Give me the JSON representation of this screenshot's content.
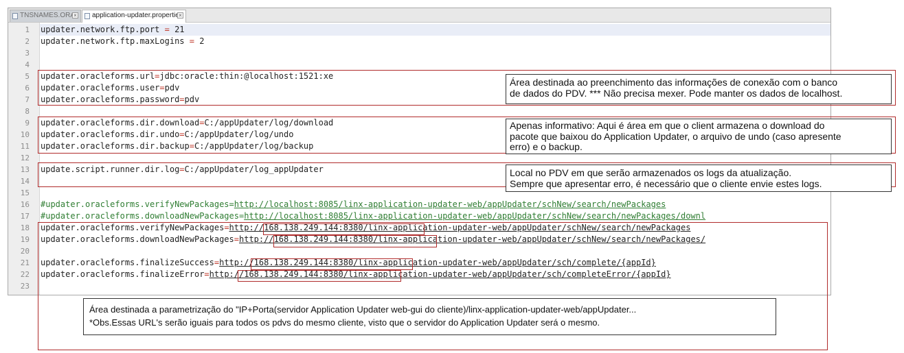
{
  "tabs": [
    {
      "label": "TNSNAMES.ORA",
      "active": false
    },
    {
      "label": "application-updater.properties",
      "active": true
    }
  ],
  "editor": {
    "line_numbers": [
      "1",
      "2",
      "3",
      "4",
      "5",
      "6",
      "7",
      "8",
      "9",
      "10",
      "11",
      "12",
      "13",
      "14",
      "15",
      "16",
      "17",
      "18",
      "19",
      "20",
      "21",
      "22",
      "23"
    ],
    "lines": [
      {
        "n": 1,
        "key": "updater.network.ftp.port",
        "op": " = ",
        "value": "21"
      },
      {
        "n": 2,
        "key": "updater.network.ftp.maxLogins",
        "op": " = ",
        "value": "2"
      },
      {
        "n": 5,
        "key": "updater.oracleforms.url",
        "op": "=",
        "value": "jdbc:oracle:thin:@localhost:1521:xe"
      },
      {
        "n": 6,
        "key": "updater.oracleforms.user",
        "op": "=",
        "value": "pdv"
      },
      {
        "n": 7,
        "key": "updater.oracleforms.password",
        "op": "=",
        "value": "pdv"
      },
      {
        "n": 9,
        "key": "updater.oracleforms.dir.download",
        "op": "=",
        "value": "C:/appUpdater/log/download"
      },
      {
        "n": 10,
        "key": "updater.oracleforms.dir.undo",
        "op": "=",
        "value": "C:/appUpdater/log/undo"
      },
      {
        "n": 11,
        "key": "updater.oracleforms.dir.backup",
        "op": "=",
        "value": "C:/appUpdater/log/backup"
      },
      {
        "n": 13,
        "key": "update.script.runner.dir.log",
        "op": "=",
        "value": "C:/appUpdater/log_appUpdater"
      },
      {
        "n": 16,
        "key": "#updater.oracleforms.verifyNewPackages",
        "op": "=",
        "value": "http://localhost:8085/linx-application-updater-web/appUpdater/schNew/search/newPackages",
        "comment": true
      },
      {
        "n": 17,
        "key": "#updater.oracleforms.downloadNewPackages",
        "op": "=",
        "value": "http://localhost:8085/linx-application-updater-web/appUpdater/schNew/search/newPackages/downl",
        "comment": true
      },
      {
        "n": 18,
        "key": "updater.oracleforms.verifyNewPackages",
        "op": "=",
        "value": "http://168.138.249.144:8380/linx-application-updater-web/appUpdater/schNew/search/newPackages"
      },
      {
        "n": 19,
        "key": "updater.oracleforms.downloadNewPackages",
        "op": "=",
        "value": "http://168.138.249.144:8380/linx-application-updater-web/appUpdater/schNew/search/newPackages/"
      },
      {
        "n": 21,
        "key": "updater.oracleforms.finalizeSuccess",
        "op": "=",
        "value": "http://168.138.249.144:8380/linx-application-updater-web/appUpdater/sch/complete/{appId}"
      },
      {
        "n": 22,
        "key": "updater.oracleforms.finalizeError",
        "op": "=",
        "value": "http://168.138.249.144:8380/linx-application-updater-web/appUpdater/sch/completeError/{appId}"
      }
    ]
  },
  "notes": {
    "db": {
      "line1": "Área destinada ao preenchimento das informações de conexão com o banco",
      "line2": "de dados do PDV. *** Não precisa mexer. Pode manter os dados de localhost."
    },
    "dirs": {
      "line1": "Apenas informativo: Aqui é área em que o client armazena o download do",
      "line2": "pacote que baixou do Application Updater, o arquivo de undo (caso apresente",
      "line3": "erro) e o backup."
    },
    "log": {
      "line1": "Local no PDV em que serão armazenados os logs da atualização.",
      "line2": "Sempre que apresentar erro, é necessário que o cliente envie estes logs."
    },
    "url": {
      "line1": "Área destinada a parametrização do \"IP+Porta(servidor Application Updater web-gui do cliente)/linx-application-updater-web/appUpdater...",
      "line2": "*Obs.Essas URL's serão iguais para todos os pdvs do mesmo cliente, visto que o servidor do Application Updater será o mesmo."
    }
  },
  "colors": {
    "outline": "#b02a2a",
    "comment": "#2f7d32",
    "operator": "#c0392b"
  }
}
